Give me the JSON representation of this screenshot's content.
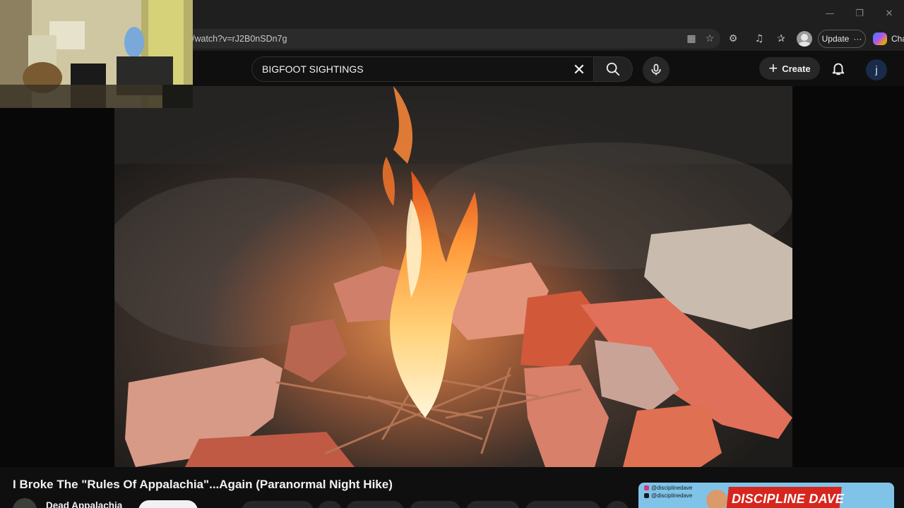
{
  "browser": {
    "url": "/watch?v=rJ2B0nSDn7g",
    "update_label": "Update",
    "more_label": "···",
    "copilot_label": "Cha",
    "icons": [
      "apps-icon",
      "favorite-star-icon",
      "extensions-icon",
      "media-control-icon",
      "favorites-icon",
      "profile-icon",
      "copilot-icon"
    ]
  },
  "youtube": {
    "search": {
      "value": "BIGFOOT SIGHTINGS"
    },
    "create_label": "Create",
    "avatar_initial": "j",
    "video": {
      "title": "I Broke The \"Rules Of Appalachia\"...Again (Paranormal Night Hike)",
      "channel_name": "Dead Appalachia"
    }
  },
  "ad": {
    "banner_text": "DISCIPLINE DAVE",
    "handle_1": "@disciplinedave",
    "handle_2": "@disciplinedave"
  },
  "colors": {
    "background": "#0f0f0f",
    "browser_chrome": "#1f1f1f",
    "ad_banner": "#d7261e",
    "ad_background": "#7fc4e8"
  }
}
